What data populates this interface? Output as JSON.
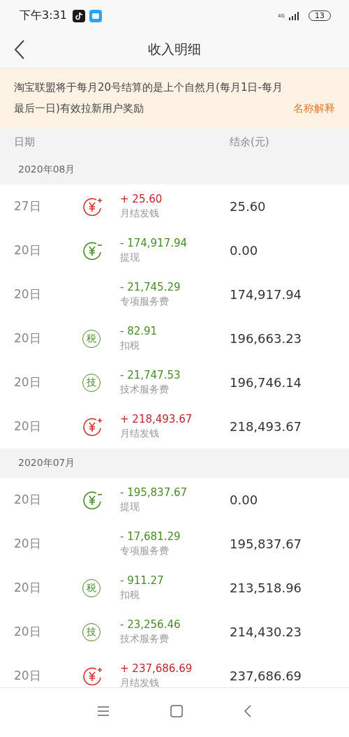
{
  "status_bar": {
    "time": "下午3:31",
    "network": "4G",
    "battery": "13"
  },
  "nav": {
    "title": "收入明细"
  },
  "notice": {
    "text": "淘宝联盟将于每月20号结算的是上个自然月(每月1日-每月最后一日)有效拉新用户奖励",
    "link": "名称解释"
  },
  "columns": [
    "日期",
    "结余(元)"
  ],
  "months": [
    {
      "label": "2020年08月",
      "rows": [
        {
          "day": "27日",
          "kind": "income",
          "amount": "+ 25.60",
          "description": "月结发钱",
          "balance": "25.60"
        },
        {
          "day": "20日",
          "kind": "withdrawal",
          "amount": "- 174,917.94",
          "description": "提现",
          "balance": "0.00"
        },
        {
          "day": "20日",
          "kind": "fee",
          "amount": "- 21,745.29",
          "description": "专项服务费",
          "balance": "174,917.94"
        },
        {
          "day": "20日",
          "kind": "badge",
          "badge": "税",
          "amount": "- 82.91",
          "description": "扣税",
          "balance": "196,663.23"
        },
        {
          "day": "20日",
          "kind": "badge",
          "badge": "技",
          "amount": "- 21,747.53",
          "description": "技术服务费",
          "balance": "196,746.14"
        },
        {
          "day": "20日",
          "kind": "income",
          "amount": "+ 218,493.67",
          "description": "月结发钱",
          "balance": "218,493.67"
        }
      ]
    },
    {
      "label": "2020年07月",
      "rows": [
        {
          "day": "20日",
          "kind": "withdrawal",
          "amount": "- 195,837.67",
          "description": "提现",
          "balance": "0.00"
        },
        {
          "day": "20日",
          "kind": "fee",
          "amount": "- 17,681.29",
          "description": "专项服务费",
          "balance": "195,837.67"
        },
        {
          "day": "20日",
          "kind": "badge",
          "badge": "税",
          "amount": "- 911.27",
          "description": "扣税",
          "balance": "213,518.96"
        },
        {
          "day": "20日",
          "kind": "badge",
          "badge": "技",
          "amount": "- 23,256.46",
          "description": "技术服务费",
          "balance": "214,430.23"
        },
        {
          "day": "20日",
          "kind": "income",
          "amount": "+ 237,686.69",
          "description": "月结发钱",
          "balance": "237,686.69"
        }
      ]
    }
  ]
}
